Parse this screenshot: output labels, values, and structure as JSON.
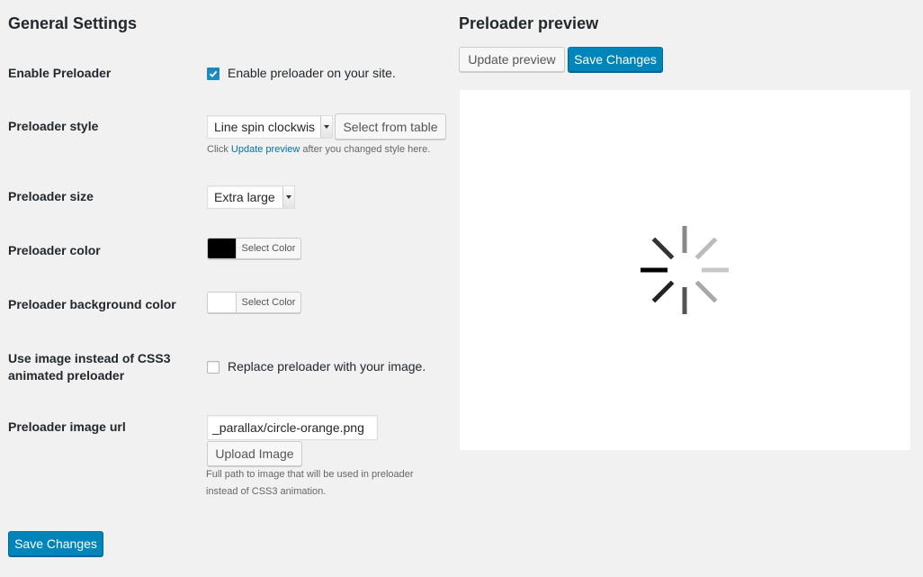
{
  "general": {
    "title": "General Settings",
    "enable": {
      "label": "Enable Preloader",
      "checked": true,
      "text": "Enable preloader on your site."
    },
    "style": {
      "label": "Preloader style",
      "value": "Line spin clockwis",
      "table_button": "Select from table",
      "hint_before": "Click ",
      "hint_link": "Update preview",
      "hint_after": " after you changed style here."
    },
    "size": {
      "label": "Preloader size",
      "value": "Extra large"
    },
    "color": {
      "label": "Preloader color",
      "button": "Select Color",
      "swatch": "#000000"
    },
    "bg_color": {
      "label": "Preloader background color",
      "button": "Select Color",
      "swatch": "#ffffff"
    },
    "use_image": {
      "label_line1": "Use image instead of CSS3",
      "label_line2": "animated preloader",
      "checked": false,
      "text": "Replace preloader with your image."
    },
    "image_url": {
      "label": "Preloader image url",
      "value": "_parallax/circle-orange.png",
      "upload_button": "Upload Image",
      "hint_line1": "Full path to image that will be used in preloader",
      "hint_line2": "instead of CSS3 animation."
    },
    "save_button": "Save Changes"
  },
  "preview": {
    "title": "Preloader preview",
    "update_button": "Update preview",
    "save_button": "Save Changes",
    "spinner_icon": "line-spin-clockwise-icon"
  },
  "colors": {
    "accent": "#0085ba",
    "link": "#0073aa",
    "background": "#f1f1f1"
  }
}
